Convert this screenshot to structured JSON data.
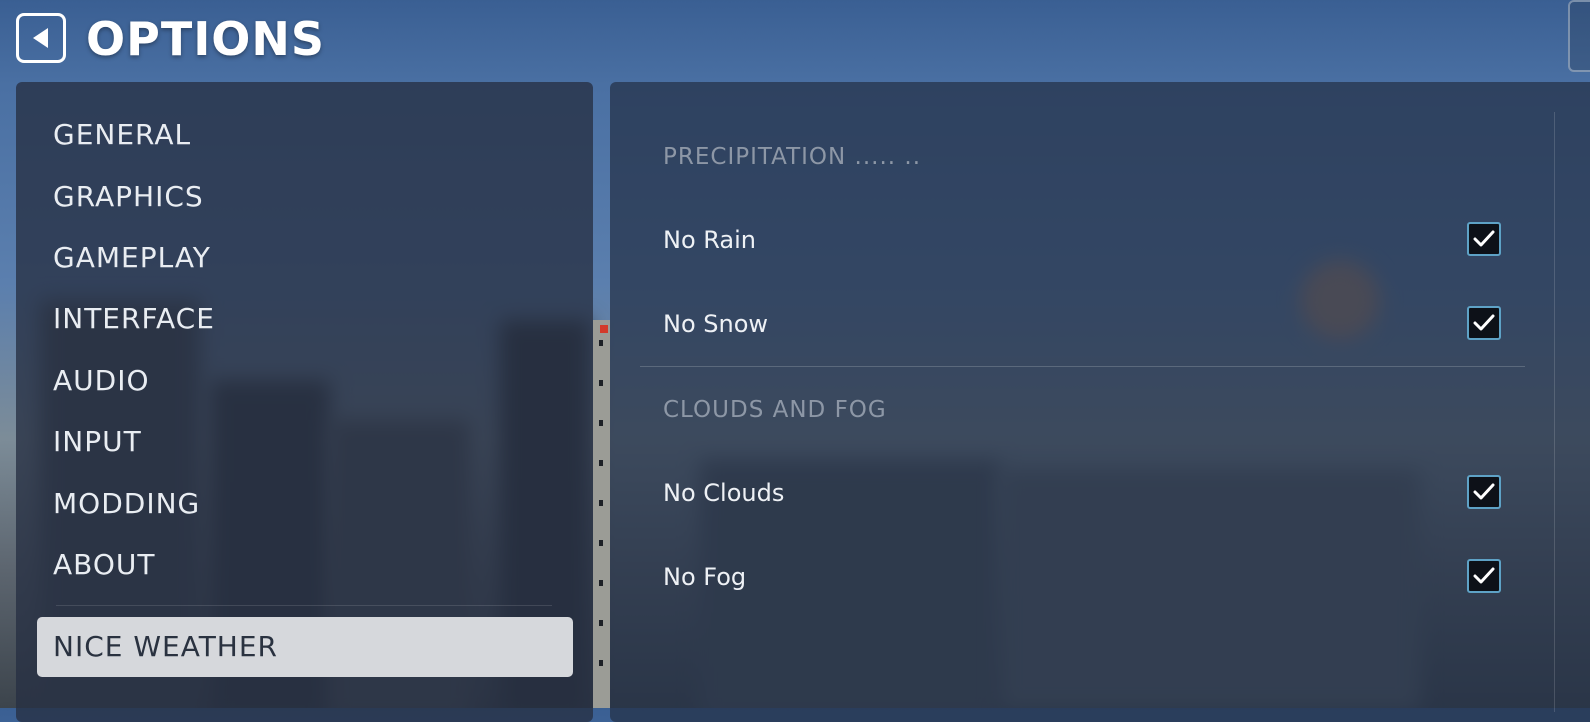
{
  "header": {
    "title": "OPTIONS",
    "back_icon": "back-arrow-icon"
  },
  "sidebar": {
    "items": [
      {
        "label": "GENERAL"
      },
      {
        "label": "GRAPHICS"
      },
      {
        "label": "GAMEPLAY"
      },
      {
        "label": "INTERFACE"
      },
      {
        "label": "AUDIO"
      },
      {
        "label": "INPUT"
      },
      {
        "label": "MODDING"
      },
      {
        "label": "ABOUT"
      }
    ],
    "active_item": {
      "label": "NICE WEATHER"
    }
  },
  "content": {
    "sections": [
      {
        "heading": "PRECIPITATION ..... ..",
        "options": [
          {
            "label": "No Rain",
            "checked": true
          },
          {
            "label": "No Snow",
            "checked": true
          }
        ]
      },
      {
        "heading": "CLOUDS AND FOG",
        "options": [
          {
            "label": "No Clouds",
            "checked": true
          },
          {
            "label": "No Fog",
            "checked": true
          }
        ]
      }
    ]
  },
  "colors": {
    "accent": "#5ea2c6",
    "active_nav_bg": "#d6d8dc",
    "panel_bg": "#263042"
  }
}
